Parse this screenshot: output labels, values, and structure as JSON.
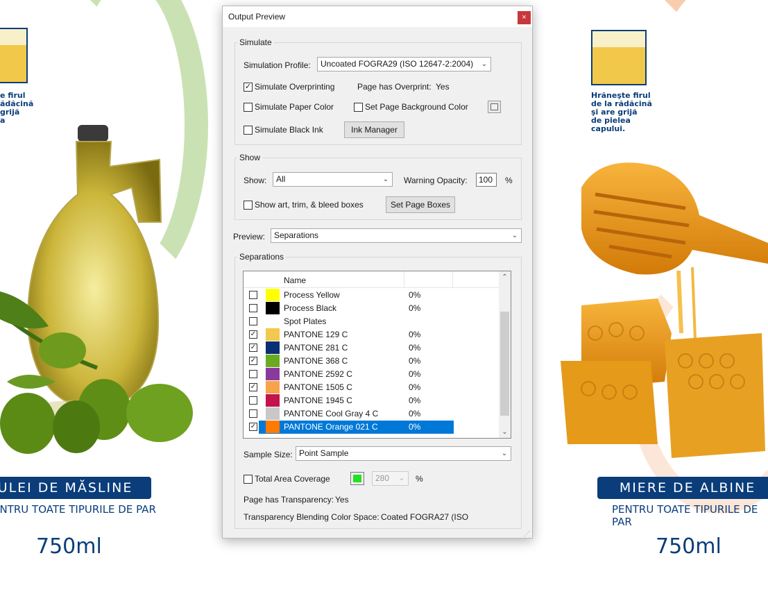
{
  "background": {
    "left_product": {
      "logo_text": [
        "e firul",
        "ădăcină",
        "grijă",
        "a"
      ],
      "name": "ULEI DE MĂSLINE",
      "subtitle": "ENTRU TOATE TIPURILE DE PAR",
      "volume": "750ml"
    },
    "right_product": {
      "logo_text": [
        "Hrăneşte firul",
        "de la rădăcină",
        "şi are grijă",
        "de pielea",
        "capului."
      ],
      "name": "MIERE DE ALBINE",
      "subtitle": "PENTRU TOATE TIPURILE DE PAR",
      "volume": "750ml"
    }
  },
  "dialog": {
    "title": "Output Preview",
    "close_glyph": "×",
    "simulate": {
      "legend": "Simulate",
      "profile_label": "Simulation Profile:",
      "profile_value": "Uncoated FOGRA29 (ISO 12647-2:2004)",
      "overprinting_label": "Simulate Overprinting",
      "overprinting_checked": true,
      "page_overprint_label": "Page has Overprint:",
      "page_overprint_value": "Yes",
      "paper_color_label": "Simulate Paper Color",
      "page_bg_label": "Set Page Background Color",
      "black_ink_label": "Simulate Black Ink",
      "ink_manager_label": "Ink Manager"
    },
    "show": {
      "legend": "Show",
      "show_label": "Show:",
      "show_value": "All",
      "warning_opacity_label": "Warning Opacity:",
      "warning_opacity_value": "100",
      "percent": "%",
      "boxes_label": "Show art, trim, & bleed boxes",
      "set_page_boxes_label": "Set Page Boxes"
    },
    "preview": {
      "label": "Preview:",
      "value": "Separations"
    },
    "separations": {
      "legend": "Separations",
      "column_name": "Name",
      "rows": [
        {
          "name": "Process Yellow",
          "pct": "0%",
          "checked": false,
          "color": "#ffff00"
        },
        {
          "name": "Process Black",
          "pct": "0%",
          "checked": false,
          "color": "#000000"
        },
        {
          "name": "Spot Plates",
          "pct": "",
          "checked": false,
          "color": ""
        },
        {
          "name": "PANTONE 129 C",
          "pct": "0%",
          "checked": true,
          "color": "#f2c94c"
        },
        {
          "name": "PANTONE 281 C",
          "pct": "0%",
          "checked": true,
          "color": "#0b2f75"
        },
        {
          "name": "PANTONE 368 C",
          "pct": "0%",
          "checked": true,
          "color": "#6aaa1f"
        },
        {
          "name": "PANTONE 2592 C",
          "pct": "0%",
          "checked": false,
          "color": "#8a3a9c"
        },
        {
          "name": "PANTONE 1505 C",
          "pct": "0%",
          "checked": true,
          "color": "#f7a34b"
        },
        {
          "name": "PANTONE 1945 C",
          "pct": "0%",
          "checked": false,
          "color": "#c4124a"
        },
        {
          "name": "PANTONE Cool Gray 4 C",
          "pct": "0%",
          "checked": false,
          "color": "#c8c8c8"
        },
        {
          "name": "PANTONE Orange 021 C",
          "pct": "0%",
          "checked": true,
          "color": "#ff7a00",
          "selected": true
        }
      ],
      "sample_size_label": "Sample Size:",
      "sample_size_value": "Point Sample",
      "total_coverage_label": "Total Area Coverage",
      "total_coverage_value": "280",
      "total_coverage_percent": "%",
      "coverage_color": "#22e022",
      "transparency_label": "Page has Transparency:",
      "transparency_value": "Yes",
      "blend_space_label": "Transparency Blending Color Space:",
      "blend_space_value": "Coated FOGRA27 (ISO"
    }
  }
}
